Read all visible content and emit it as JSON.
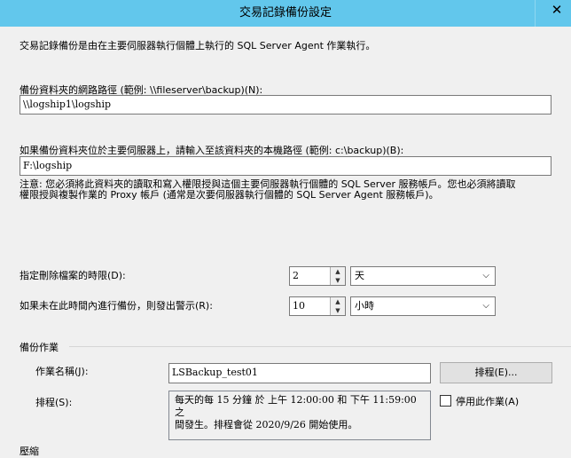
{
  "window": {
    "title": "交易記錄備份設定",
    "close_label": "✕"
  },
  "intro_text": "交易記錄備份是由在主要伺服器執行個體上執行的 SQL Server Agent 作業執行。",
  "network_path": {
    "label": "備份資料夾的網路路徑 (範例: \\\\fileserver\\backup)(N):",
    "value": "\\\\logship1\\logship"
  },
  "local_path": {
    "label": "如果備份資料夾位於主要伺服器上，請輸入至該資料夾的本機路徑 (範例: c:\\backup)(B):",
    "value": "F:\\logship"
  },
  "note": {
    "line1": "注意: 您必須將此資料夾的讀取和寫入權限授與這個主要伺服器執行個體的 SQL Server 服務帳戶。您也必須將讀取",
    "line2": "權限授與複製作業的 Proxy 帳戶 (通常是次要伺服器執行個體的 SQL Server Agent 服務帳戶)。"
  },
  "delete_files": {
    "label": "指定刪除檔案的時限(D):",
    "value": "2",
    "unit": "天"
  },
  "alert": {
    "label": "如果未在此時間內進行備份，則發出警示(R):",
    "value": "10",
    "unit": "小時"
  },
  "backup_job": {
    "group_label": "備份作業",
    "job_name_label": "作業名稱(J):",
    "job_name_value": "LSBackup_test01",
    "schedule_button": "排程(E)...",
    "schedule_label": "排程(S):",
    "schedule_line1": "每天的每 15 分鐘 於 上午 12:00:00 和 下午 11:59:00 之",
    "schedule_line2": "間發生。排程會從 2020/9/26 開始使用。",
    "disable_job_label": "停用此作業(A)",
    "disable_job_checked": false
  },
  "compression": {
    "group_label": "壓縮"
  },
  "icons": {
    "spin_up": "▲",
    "spin_down": "▼",
    "dropdown": "⌵"
  }
}
